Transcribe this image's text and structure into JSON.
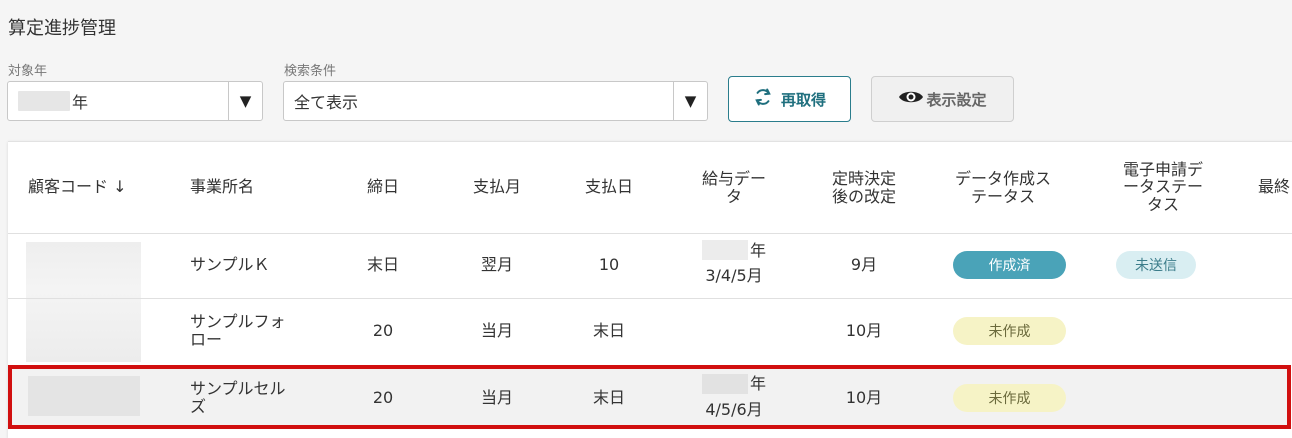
{
  "page": {
    "title": "算定進捗管理"
  },
  "filters": {
    "year_label": "対象年",
    "year_value_suffix": "年",
    "search_label": "検索条件",
    "search_value": "全て表示",
    "dropdown_arrow": "▼"
  },
  "buttons": {
    "refresh_label": "再取得",
    "display_settings_label": "表示設定"
  },
  "table": {
    "columns": [
      "顧客コード ↓",
      "事業所名",
      "締日",
      "支払月",
      "支払日",
      "給与デー\nタ",
      "定時決定\n後の改定",
      "データ作成ス\nテータス",
      "電子申請デ\nータステー\nタス",
      "最終"
    ],
    "rows": [
      {
        "office": "サンプルＫ",
        "closing": "末日",
        "pay_month": "翌月",
        "pay_day": "10",
        "salary_year": "年",
        "salary_months": "3/4/5月",
        "revision": "9月",
        "creation_status": "作成済",
        "e_status": "未送信"
      },
      {
        "office": "サンプルフォ\nロー",
        "closing": "20",
        "pay_month": "当月",
        "pay_day": "末日",
        "salary_year": "",
        "salary_months": "",
        "revision": "10月",
        "creation_status": "未作成",
        "e_status": ""
      },
      {
        "office": "サンプルセル\nズ",
        "closing": "20",
        "pay_month": "当月",
        "pay_day": "末日",
        "salary_year": "年",
        "salary_months": "4/5/6月",
        "revision": "10月",
        "creation_status": "未作成",
        "e_status": ""
      }
    ]
  },
  "colors": {
    "accent": "#2a7d8c",
    "highlight_border": "#d10f0f",
    "status_done": "#4aa3b8",
    "status_pending": "#f6f3c6",
    "status_unsent": "#d9eef2"
  }
}
